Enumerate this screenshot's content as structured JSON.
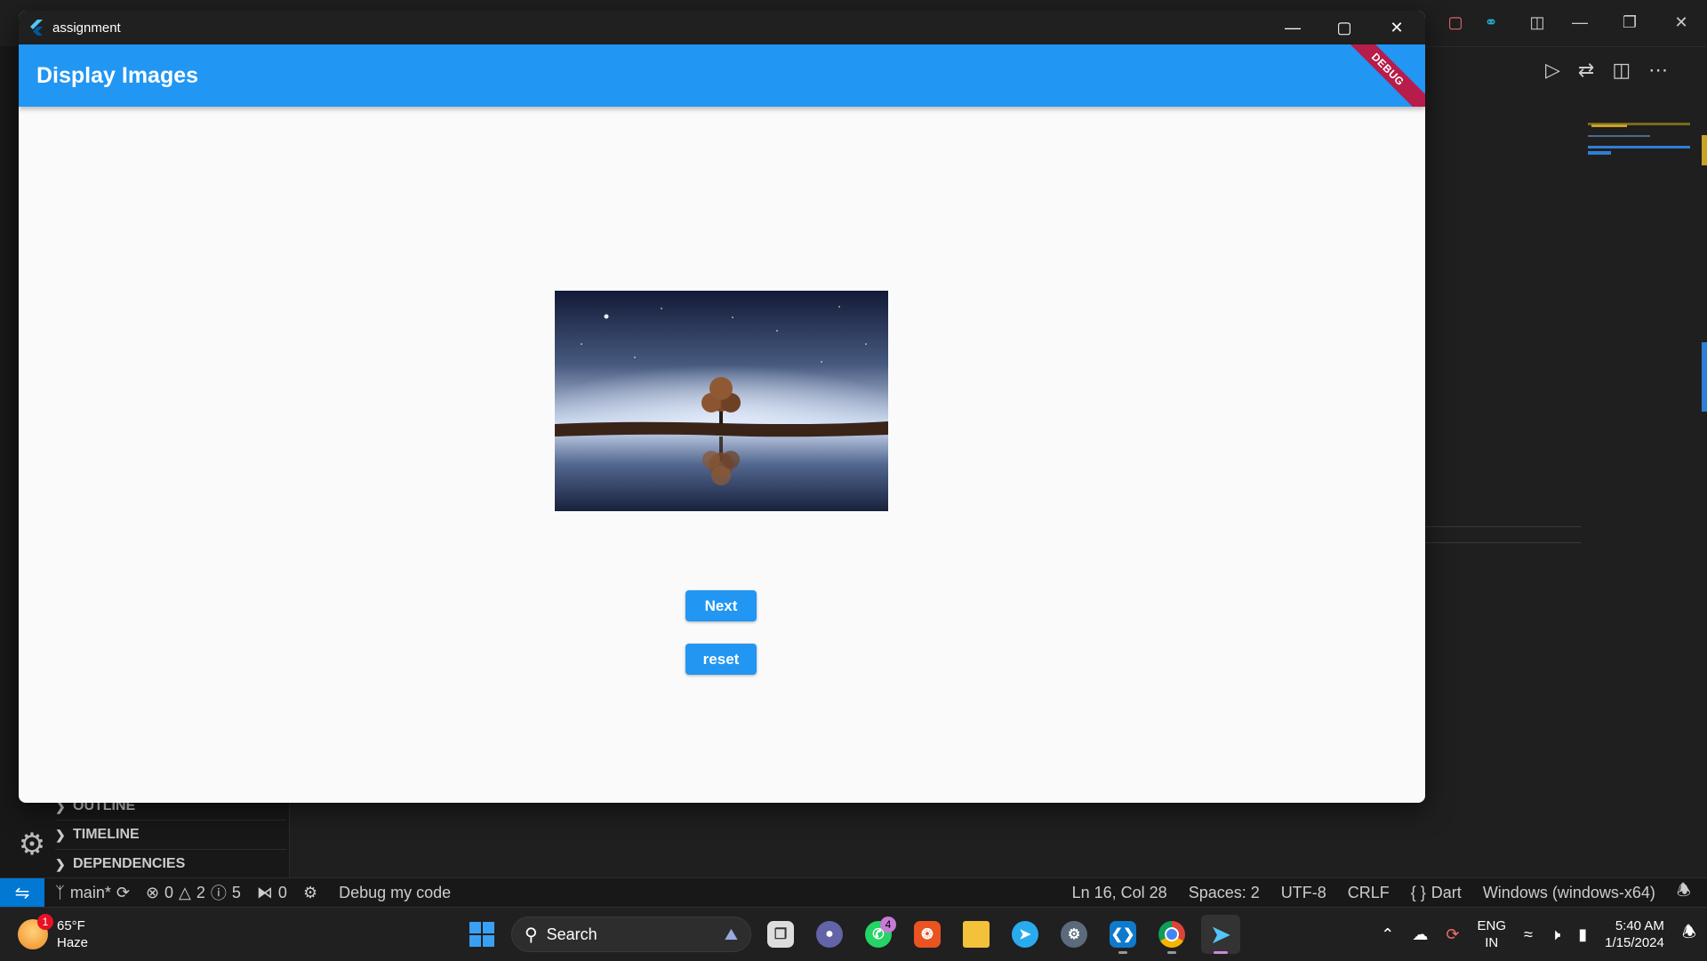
{
  "vscode": {
    "sidebar_sections": [
      "OUTLINE",
      "TIMELINE",
      "DEPENDENCIES"
    ],
    "statusbar": {
      "branch": "main*",
      "errors": "0",
      "warnings": "2",
      "infos": "5",
      "ports": "0",
      "debug_label": "Debug my code",
      "position": "Ln 16, Col 28",
      "spaces": "Spaces: 2",
      "encoding": "UTF-8",
      "eol": "CRLF",
      "language": "Dart",
      "platform": "Windows (windows-x64)"
    }
  },
  "app_window": {
    "window_title": "assignment",
    "appbar_title": "Display Images",
    "debug_banner": "DEBUG",
    "image_icon": "night-tree-reflection-image",
    "buttons": {
      "next_label": "Next",
      "reset_label": "reset"
    },
    "accent_color": "#2196f3"
  },
  "taskbar": {
    "weather": {
      "temp": "65°F",
      "condition": "Haze",
      "badge": "1"
    },
    "search_placeholder": "Search",
    "whatsapp_badge": "4",
    "language": {
      "line1": "ENG",
      "line2": "IN"
    },
    "time": "5:40 AM",
    "date": "1/15/2024"
  }
}
